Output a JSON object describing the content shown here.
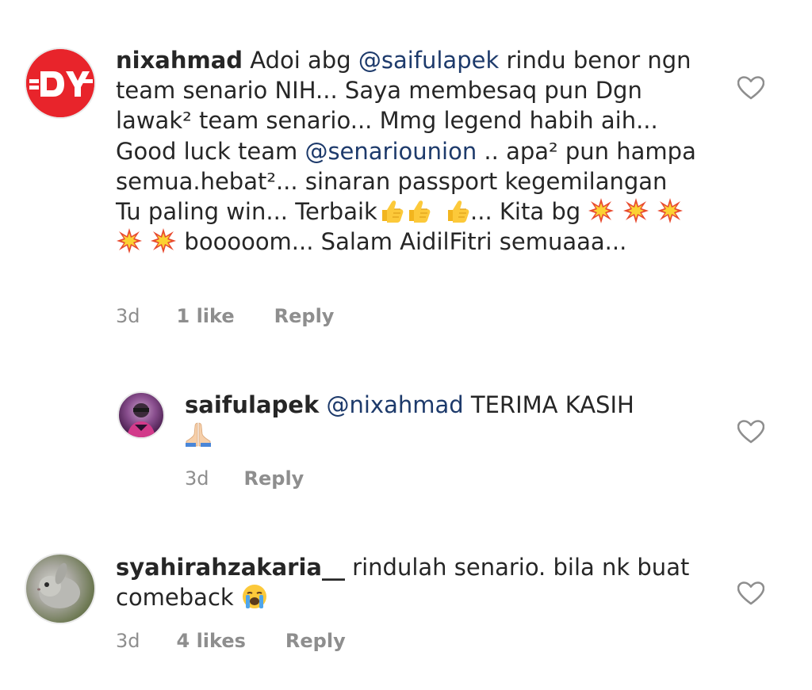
{
  "comments": [
    {
      "username": "nixahmad",
      "segments": {
        "t1": " Adoi abg ",
        "m1": "@saifulapek",
        "t2": "  rindu benor ngn team senario NIH... Saya membesaq pun Dgn lawak² team senario... Mmg legend habih aih... Good luck team ",
        "m2": "@senariounion",
        "t3": " .. apa² pun hampa semua.hebat²... sinaran passport kegemilangan Tu paling win... Terbaik",
        "t4": "... Kita bg ",
        "t5": " booooom... Salam AidilFitri semuaaa..."
      },
      "time": "3d",
      "likes": "1 like",
      "reply_label": "Reply",
      "avatar_icon": "dy-logo-avatar",
      "avatar_color": "#e8242b"
    },
    {
      "username": "saifulapek",
      "segments": {
        "m1": "@nixahmad",
        "t1": " TERIMA KASIH"
      },
      "time": "3d",
      "reply_label": "Reply",
      "avatar_icon": "profile-photo-avatar"
    },
    {
      "username": "syahirahzakaria__",
      "segments": {
        "t1": " rindulah senario. bila nk buat comeback "
      },
      "time": "3d",
      "likes": "4 likes",
      "reply_label": "Reply",
      "avatar_icon": "rabbit-photo-avatar"
    }
  ],
  "icons": {
    "like": "heart-outline-icon",
    "thumbs_up": "thumbs-up-emoji",
    "collision": "collision-emoji",
    "pray": "folded-hands-emoji",
    "crying": "loudly-crying-face-emoji"
  },
  "colors": {
    "text": "#262626",
    "mention": "#1d3a6b",
    "meta": "#8e8e8e"
  }
}
